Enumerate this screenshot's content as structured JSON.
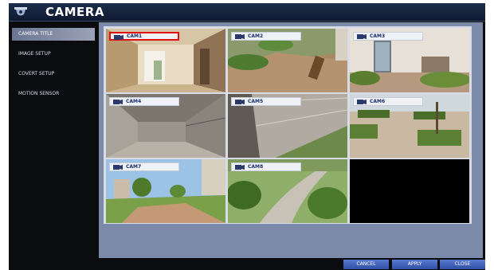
{
  "window": {
    "title": "CAMERA",
    "accent": "#1d2c4d"
  },
  "sidebar": {
    "items": [
      {
        "label": "CAMERA TITLE",
        "active": true
      },
      {
        "label": "IMAGE SETUP",
        "active": false
      },
      {
        "label": "COVERT SETUP",
        "active": false
      },
      {
        "label": "MOTION SENSOR",
        "active": false
      }
    ]
  },
  "cameras": [
    {
      "label": "CAM1",
      "selected": true
    },
    {
      "label": "CAM2",
      "selected": false
    },
    {
      "label": "CAM3",
      "selected": false
    },
    {
      "label": "CAM4",
      "selected": false
    },
    {
      "label": "CAM5",
      "selected": false
    },
    {
      "label": "CAM6",
      "selected": false
    },
    {
      "label": "CAM7",
      "selected": false
    },
    {
      "label": "CAM8",
      "selected": false
    }
  ],
  "buttons": {
    "cancel": "CANCEL",
    "apply": "APPLY",
    "close": "CLOSE"
  },
  "colors": {
    "selection": "#e01010",
    "button": "#3f5fb8"
  }
}
